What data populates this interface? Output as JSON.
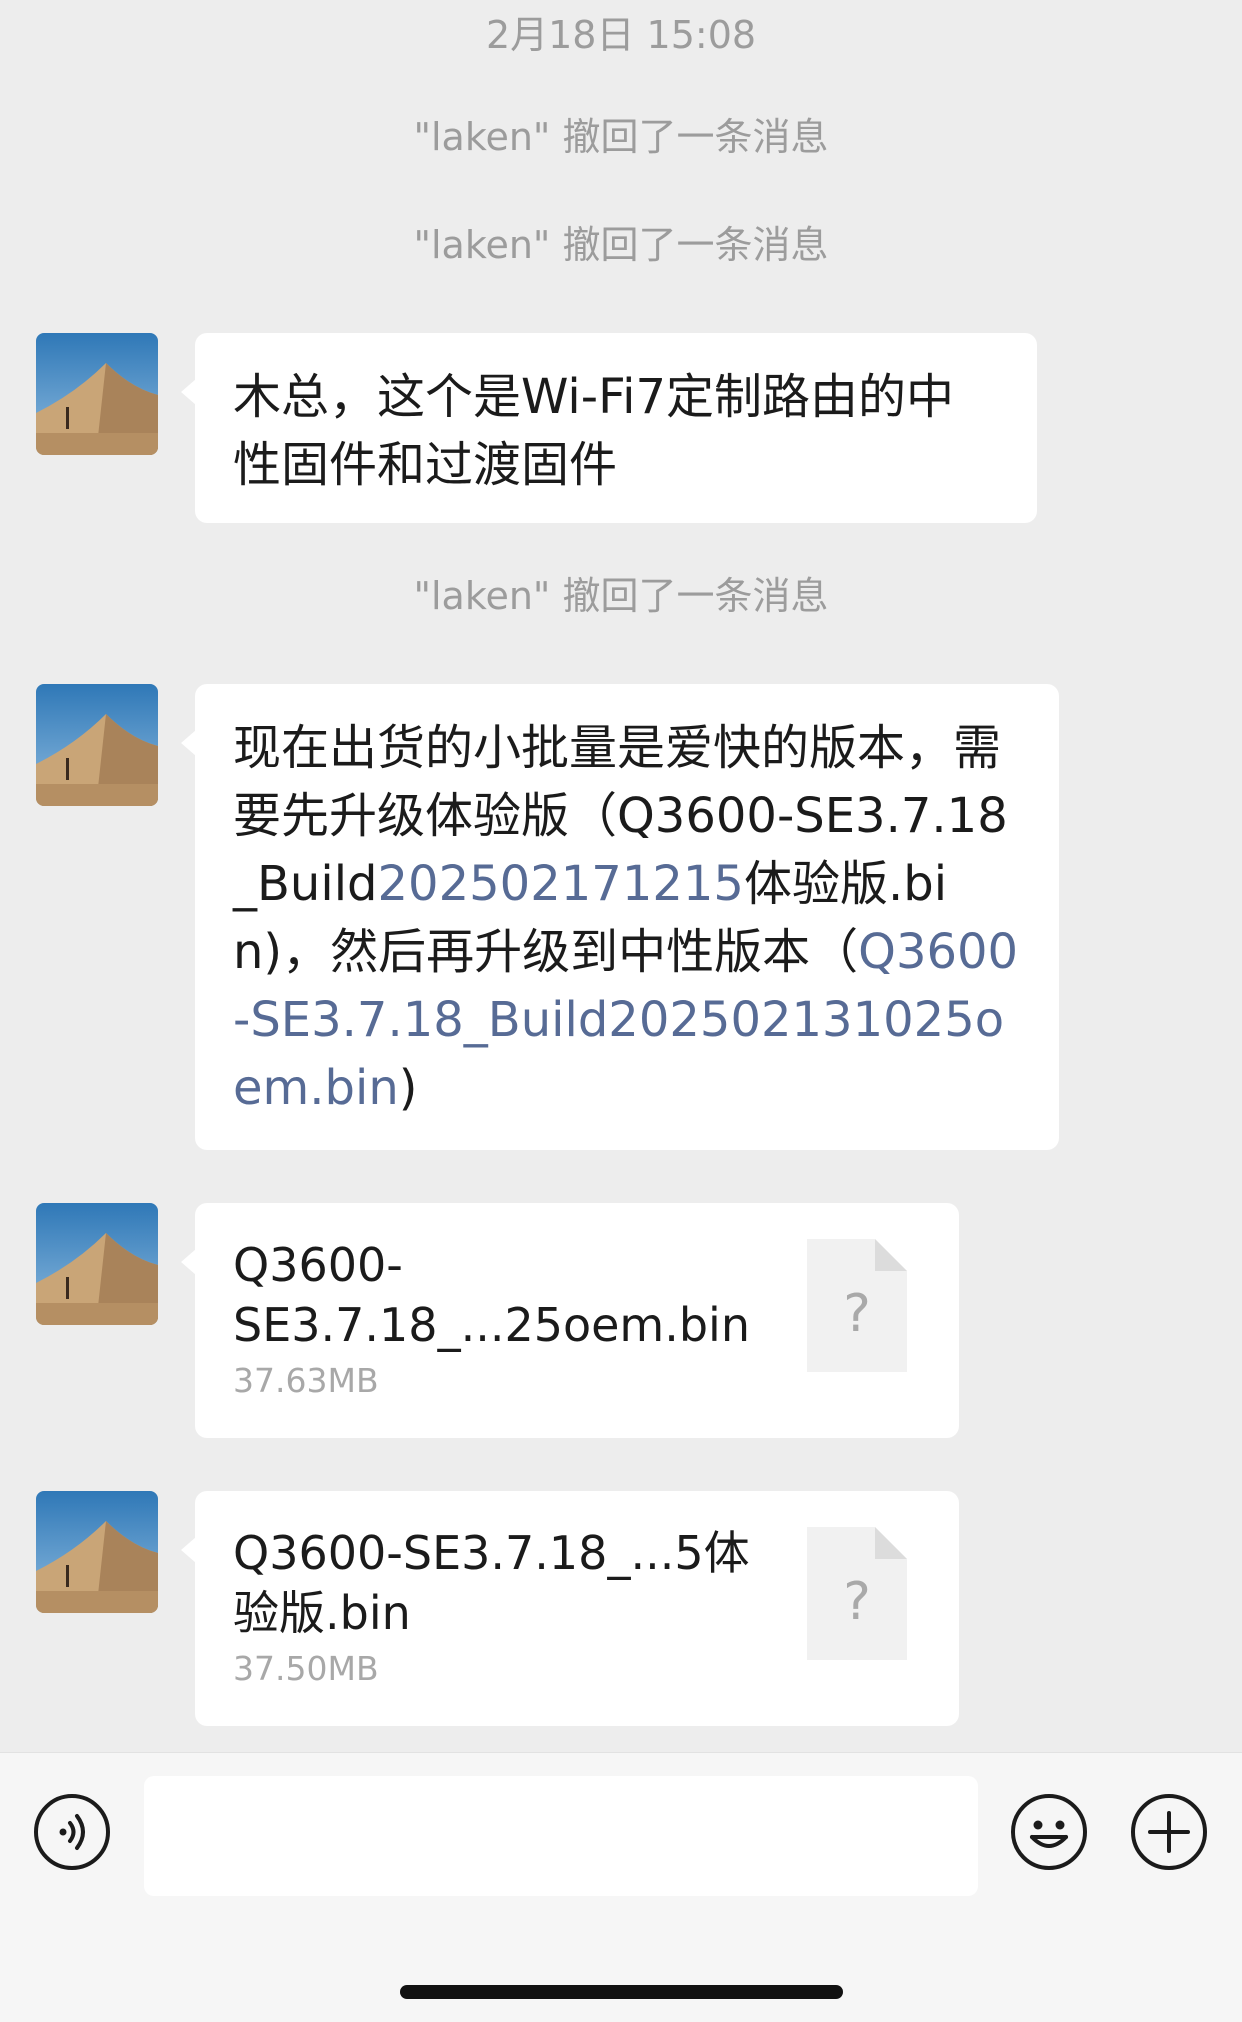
{
  "chat": {
    "timestamp": "2月18日 15:08",
    "recall_notices": [
      "\"laken\" 撤回了一条消息",
      "\"laken\" 撤回了一条消息",
      "\"laken\" 撤回了一条消息"
    ],
    "messages": [
      {
        "type": "text",
        "text": "木总，这个是Wi-Fi7定制路由的中性固件和过渡固件"
      },
      {
        "type": "text",
        "segments": {
          "t1": "现在出货的小批量是爱快的版本，需要先升级体验版（Q3600-SE3.7.18_Build",
          "t2": "202502171215",
          "t3": "体验版.bin)，然后再升级到中性版本（",
          "t4": "Q3600-SE3.7.18_Build202502131025oem.bin",
          "t5": ")"
        }
      },
      {
        "type": "file",
        "name": "Q3600-SE3.7.18_...25oem.bin",
        "size": "37.63MB",
        "icon": "unknown-file-icon",
        "icon_glyph": "?"
      },
      {
        "type": "file",
        "name": "Q3600-SE3.7.18_...5体验版.bin",
        "size": "37.50MB",
        "icon": "unknown-file-icon",
        "icon_glyph": "?"
      }
    ]
  },
  "input_bar": {
    "voice_icon": "voice-icon",
    "emoji_icon": "emoji-icon",
    "add_icon": "plus-circle-icon"
  },
  "colors": {
    "background": "#ededed",
    "bubble": "#ffffff",
    "link": "#576b95",
    "system_text": "#9c9c9c"
  }
}
